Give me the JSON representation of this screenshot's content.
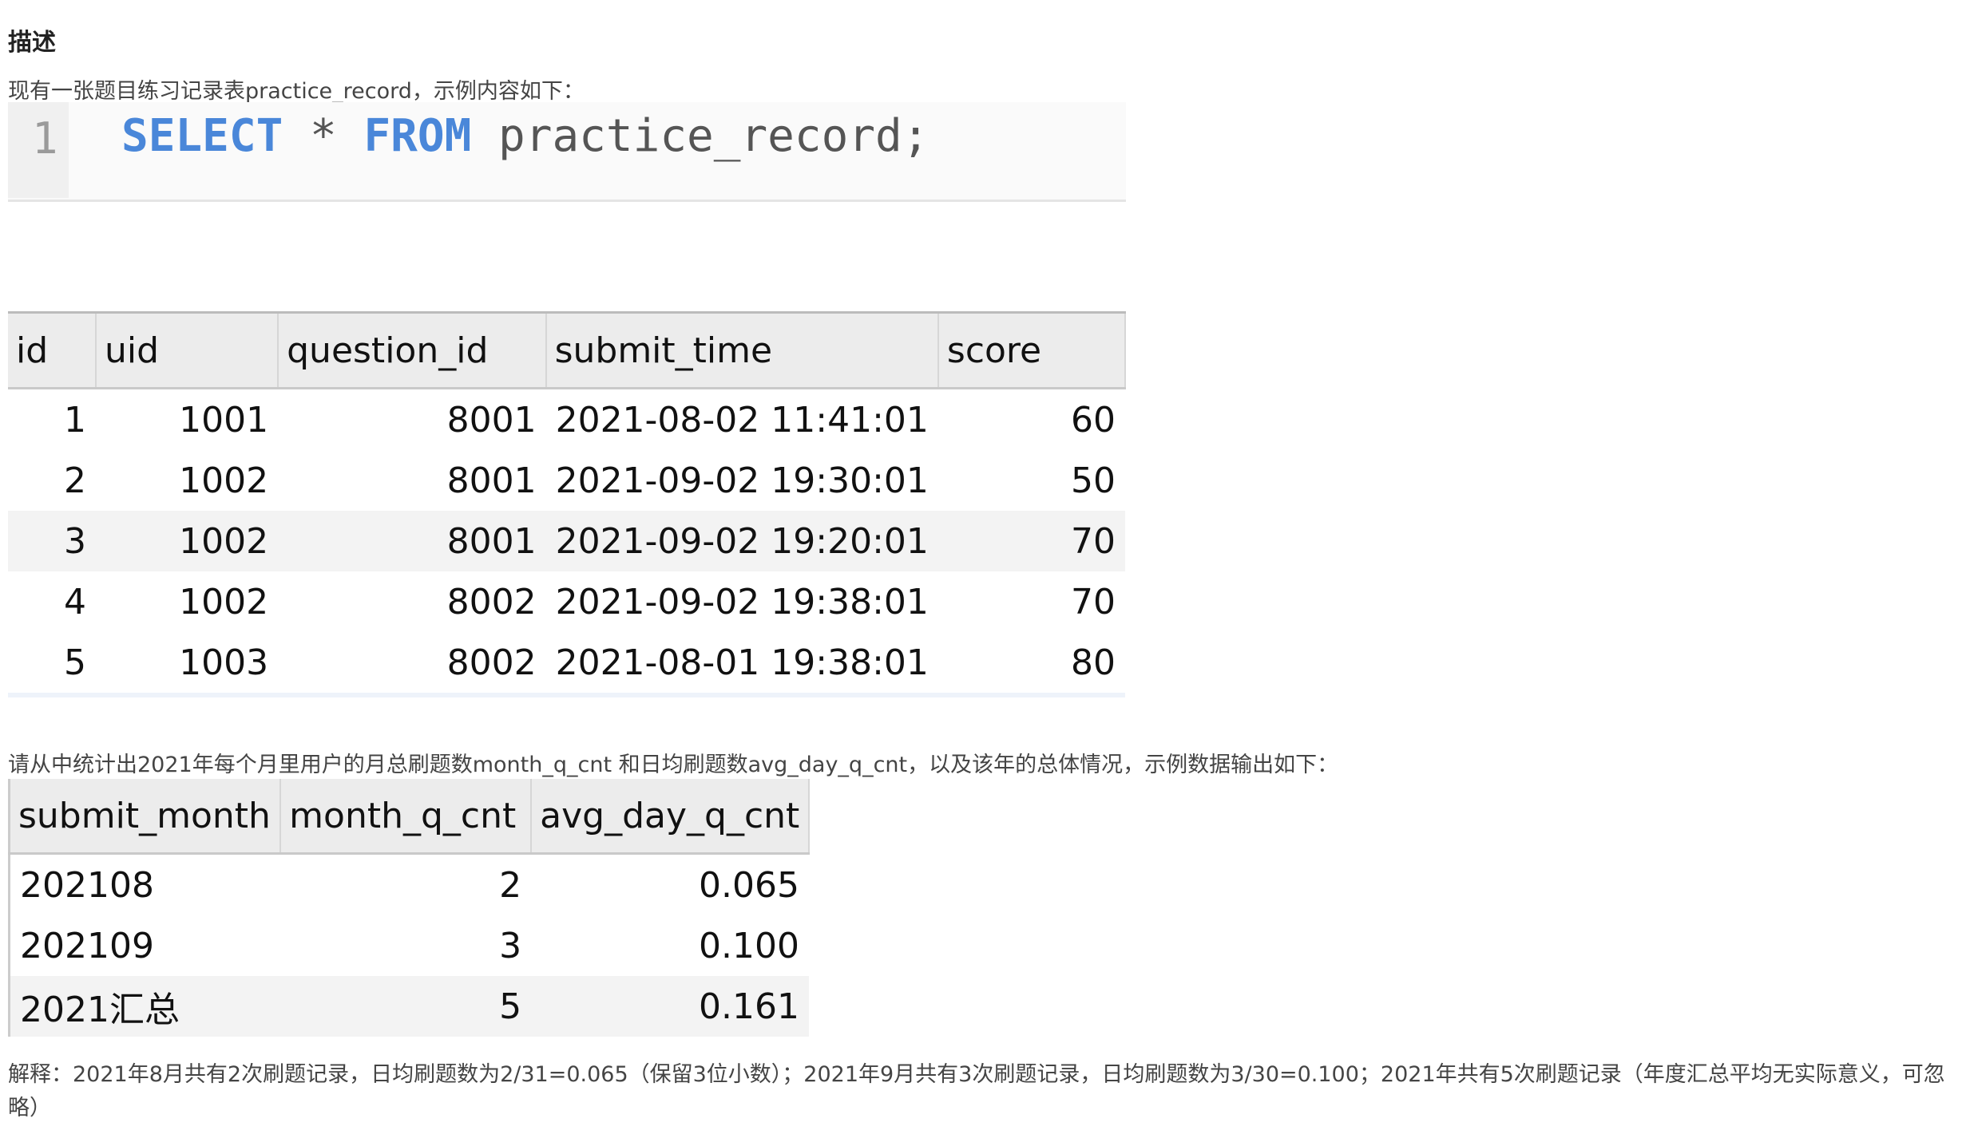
{
  "description": {
    "heading": "描述",
    "intro": "现有一张题目练习记录表practice_record，示例内容如下：",
    "question": "请从中统计出2021年每个月里用户的月总刷题数month_q_cnt 和日均刷题数avg_day_q_cnt，以及该年的总体情况，示例数据输出如下：",
    "explanation": "解释：2021年8月共有2次刷题记录，日均刷题数为2/31=0.065（保留3位小数）；2021年9月共有3次刷题记录，日均刷题数为3/30=0.100；2021年共有5次刷题记录（年度汇总平均无实际意义，可忽略）"
  },
  "code": {
    "line_number": "1",
    "kw_select": "SELECT",
    "star": " * ",
    "kw_from": "FROM",
    "rest": " practice_record;"
  },
  "practice_record": {
    "columns": [
      "id",
      "uid",
      "question_id",
      "submit_time",
      "score"
    ],
    "rows": [
      [
        "1",
        "1001",
        "8001",
        "2021-08-02 11:41:01",
        "60"
      ],
      [
        "2",
        "1002",
        "8001",
        "2021-09-02 19:30:01",
        "50"
      ],
      [
        "3",
        "1002",
        "8001",
        "2021-09-02 19:20:01",
        "70"
      ],
      [
        "4",
        "1002",
        "8002",
        "2021-09-02 19:38:01",
        "70"
      ],
      [
        "5",
        "1003",
        "8002",
        "2021-08-01 19:38:01",
        "80"
      ]
    ]
  },
  "result": {
    "columns": [
      "submit_month",
      "month_q_cnt",
      "avg_day_q_cnt"
    ],
    "rows": [
      [
        "202108",
        "2",
        "0.065"
      ],
      [
        "202109",
        "3",
        "0.100"
      ],
      [
        "2021汇总",
        "5",
        "0.161"
      ]
    ]
  },
  "colors": {
    "keyword": "#4a87d9",
    "header_bg": "#ececec",
    "alt_row_bg": "#f3f3f3"
  }
}
